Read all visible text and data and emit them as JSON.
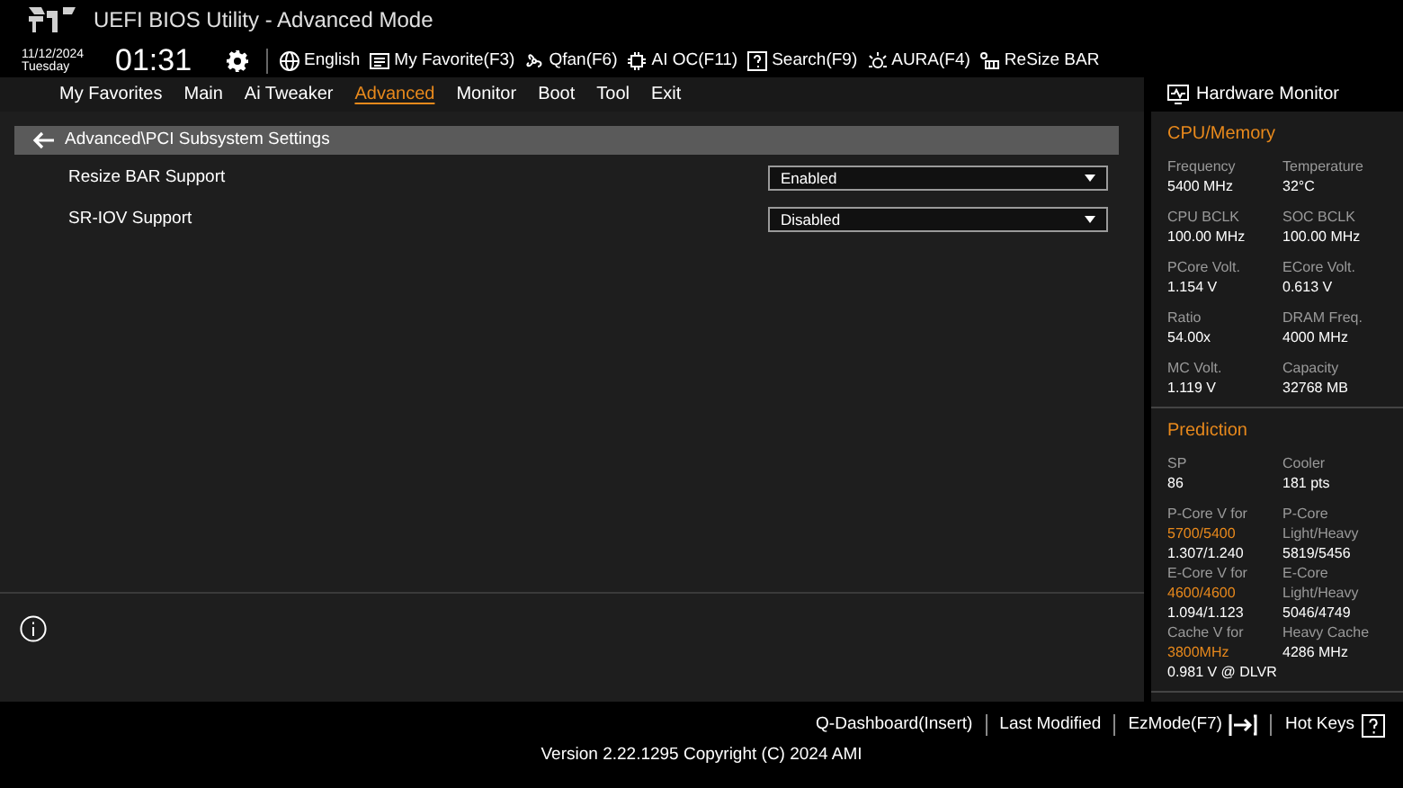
{
  "window": {
    "title": "UEFI BIOS Utility - Advanced Mode"
  },
  "clock": {
    "date": "11/12/2024",
    "day": "Tuesday",
    "time": "01:31"
  },
  "toolbar": [
    {
      "kind": "globe",
      "label": "English"
    },
    {
      "kind": "favorite",
      "label": "My Favorite(F3)"
    },
    {
      "kind": "fan",
      "label": "Qfan(F6)"
    },
    {
      "kind": "chip",
      "label": "AI OC(F11)"
    },
    {
      "kind": "search",
      "label": "Search(F9)"
    },
    {
      "kind": "aura",
      "label": "AURA(F4)"
    },
    {
      "kind": "bar",
      "label": "ReSize BAR"
    }
  ],
  "tabs": [
    {
      "label": "My Favorites",
      "selected": false
    },
    {
      "label": "Main",
      "selected": false
    },
    {
      "label": "Ai Tweaker",
      "selected": false
    },
    {
      "label": "Advanced",
      "selected": true
    },
    {
      "label": "Monitor",
      "selected": false
    },
    {
      "label": "Boot",
      "selected": false
    },
    {
      "label": "Tool",
      "selected": false
    },
    {
      "label": "Exit",
      "selected": false
    }
  ],
  "breadcrumb": "Advanced\\PCI Subsystem Settings",
  "settings": [
    {
      "label": "Resize BAR Support",
      "value": "Enabled"
    },
    {
      "label": "SR-IOV Support",
      "value": "Disabled"
    }
  ],
  "hardware_monitor": {
    "title": "Hardware Monitor",
    "sections": [
      {
        "title": "CPU/Memory",
        "items": [
          {
            "lines": [
              {
                "kind": "label",
                "text": "Frequency"
              },
              {
                "kind": "value",
                "text": "5400 MHz"
              }
            ]
          },
          {
            "lines": [
              {
                "kind": "label",
                "text": "Temperature"
              },
              {
                "kind": "value",
                "text": "32°C"
              }
            ]
          },
          {
            "lines": [
              {
                "kind": "label",
                "text": "CPU BCLK"
              },
              {
                "kind": "value",
                "text": "100.00 MHz"
              }
            ]
          },
          {
            "lines": [
              {
                "kind": "label",
                "text": "SOC BCLK"
              },
              {
                "kind": "value",
                "text": "100.00 MHz"
              }
            ]
          },
          {
            "lines": [
              {
                "kind": "label",
                "text": "PCore Volt."
              },
              {
                "kind": "value",
                "text": "1.154 V"
              }
            ]
          },
          {
            "lines": [
              {
                "kind": "label",
                "text": "ECore Volt."
              },
              {
                "kind": "value",
                "text": "0.613 V"
              }
            ]
          },
          {
            "lines": [
              {
                "kind": "label",
                "text": "Ratio"
              },
              {
                "kind": "value",
                "text": "54.00x"
              }
            ]
          },
          {
            "lines": [
              {
                "kind": "label",
                "text": "DRAM Freq."
              },
              {
                "kind": "value",
                "text": "4000 MHz"
              }
            ]
          },
          {
            "lines": [
              {
                "kind": "label",
                "text": "MC Volt."
              },
              {
                "kind": "value",
                "text": "1.119 V"
              }
            ]
          },
          {
            "lines": [
              {
                "kind": "label",
                "text": "Capacity"
              },
              {
                "kind": "value",
                "text": "32768 MB"
              }
            ]
          }
        ]
      },
      {
        "title": "Prediction",
        "items": [
          {
            "lines": [
              {
                "kind": "label",
                "text": "SP"
              },
              {
                "kind": "value",
                "text": "86"
              }
            ]
          },
          {
            "lines": [
              {
                "kind": "label",
                "text": "Cooler"
              },
              {
                "kind": "value",
                "text": "181 pts"
              }
            ]
          },
          {
            "lines": [
              {
                "kind": "label",
                "text": "P-Core V for"
              },
              {
                "kind": "accent",
                "text": "5700/5400"
              },
              {
                "kind": "value",
                "text": "1.307/1.240"
              },
              {
                "kind": "label",
                "text": "E-Core V for"
              },
              {
                "kind": "accent",
                "text": "4600/4600"
              },
              {
                "kind": "value",
                "text": "1.094/1.123"
              },
              {
                "kind": "label",
                "text": "Cache V for"
              },
              {
                "kind": "accent",
                "text": "3800MHz"
              },
              {
                "kind": "value",
                "text": "0.981 V @ DLVR"
              }
            ]
          },
          {
            "lines": [
              {
                "kind": "label",
                "text": "P-Core"
              },
              {
                "kind": "label",
                "text": "Light/Heavy"
              },
              {
                "kind": "value",
                "text": "5819/5456"
              },
              {
                "kind": "label",
                "text": "E-Core"
              },
              {
                "kind": "label",
                "text": "Light/Heavy"
              },
              {
                "kind": "value",
                "text": "5046/4749"
              },
              {
                "kind": "label",
                "text": "Heavy Cache"
              },
              {
                "kind": "value",
                "text": "4286 MHz"
              }
            ]
          }
        ]
      }
    ]
  },
  "footer": {
    "actions": [
      {
        "kind": "text",
        "label": "Q-Dashboard(Insert)"
      },
      {
        "kind": "text",
        "label": "Last Modified"
      },
      {
        "kind": "exit",
        "label": "EzMode(F7)"
      },
      {
        "kind": "help",
        "label": "Hot Keys"
      }
    ],
    "version": "Version 2.22.1295 Copyright (C) 2024 AMI"
  }
}
